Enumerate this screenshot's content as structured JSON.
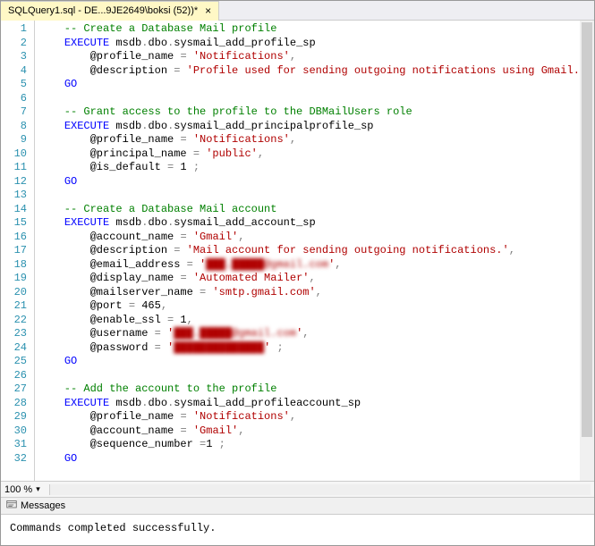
{
  "tab": {
    "title": "SQLQuery1.sql - DE...9JE2649\\boksi (52))*",
    "close": "×"
  },
  "status": {
    "zoom": "100 %",
    "drop": "▾"
  },
  "messages": {
    "header": "Messages",
    "body": "Commands completed successfully."
  },
  "code": {
    "lines": [
      {
        "n": "1",
        "parts": [
          {
            "cls": "c-comment",
            "t": "    -- Create a Database Mail profile"
          }
        ]
      },
      {
        "n": "2",
        "parts": [
          {
            "cls": "",
            "t": "    "
          },
          {
            "cls": "c-kw",
            "t": "EXECUTE"
          },
          {
            "cls": "",
            "t": " msdb"
          },
          {
            "cls": "c-gray",
            "t": "."
          },
          {
            "cls": "",
            "t": "dbo"
          },
          {
            "cls": "c-gray",
            "t": "."
          },
          {
            "cls": "",
            "t": "sysmail_add_profile_sp"
          }
        ]
      },
      {
        "n": "3",
        "parts": [
          {
            "cls": "",
            "t": "        @profile_name "
          },
          {
            "cls": "c-gray",
            "t": "="
          },
          {
            "cls": "",
            "t": " "
          },
          {
            "cls": "c-str",
            "t": "'Notifications'"
          },
          {
            "cls": "c-gray",
            "t": ","
          }
        ]
      },
      {
        "n": "4",
        "parts": [
          {
            "cls": "",
            "t": "        @description "
          },
          {
            "cls": "c-gray",
            "t": "="
          },
          {
            "cls": "",
            "t": " "
          },
          {
            "cls": "c-str",
            "t": "'Profile used for sending outgoing notifications using Gmail.'"
          },
          {
            "cls": "",
            "t": " "
          },
          {
            "cls": "c-gray",
            "t": ";"
          }
        ]
      },
      {
        "n": "5",
        "parts": [
          {
            "cls": "",
            "t": "    "
          },
          {
            "cls": "c-kw",
            "t": "GO"
          }
        ]
      },
      {
        "n": "6",
        "parts": [
          {
            "cls": "",
            "t": ""
          }
        ]
      },
      {
        "n": "7",
        "parts": [
          {
            "cls": "c-comment",
            "t": "    -- Grant access to the profile to the DBMailUsers role"
          }
        ]
      },
      {
        "n": "8",
        "parts": [
          {
            "cls": "",
            "t": "    "
          },
          {
            "cls": "c-kw",
            "t": "EXECUTE"
          },
          {
            "cls": "",
            "t": " msdb"
          },
          {
            "cls": "c-gray",
            "t": "."
          },
          {
            "cls": "",
            "t": "dbo"
          },
          {
            "cls": "c-gray",
            "t": "."
          },
          {
            "cls": "",
            "t": "sysmail_add_principalprofile_sp"
          }
        ]
      },
      {
        "n": "9",
        "parts": [
          {
            "cls": "",
            "t": "        @profile_name "
          },
          {
            "cls": "c-gray",
            "t": "="
          },
          {
            "cls": "",
            "t": " "
          },
          {
            "cls": "c-str",
            "t": "'Notifications'"
          },
          {
            "cls": "c-gray",
            "t": ","
          }
        ]
      },
      {
        "n": "10",
        "parts": [
          {
            "cls": "",
            "t": "        @principal_name "
          },
          {
            "cls": "c-gray",
            "t": "="
          },
          {
            "cls": "",
            "t": " "
          },
          {
            "cls": "c-str",
            "t": "'public'"
          },
          {
            "cls": "c-gray",
            "t": ","
          }
        ]
      },
      {
        "n": "11",
        "parts": [
          {
            "cls": "",
            "t": "        @is_default "
          },
          {
            "cls": "c-gray",
            "t": "="
          },
          {
            "cls": "",
            "t": " 1 "
          },
          {
            "cls": "c-gray",
            "t": ";"
          }
        ]
      },
      {
        "n": "12",
        "parts": [
          {
            "cls": "",
            "t": "    "
          },
          {
            "cls": "c-kw",
            "t": "GO"
          }
        ]
      },
      {
        "n": "13",
        "parts": [
          {
            "cls": "",
            "t": ""
          }
        ]
      },
      {
        "n": "14",
        "parts": [
          {
            "cls": "c-comment",
            "t": "    -- Create a Database Mail account"
          }
        ]
      },
      {
        "n": "15",
        "parts": [
          {
            "cls": "",
            "t": "    "
          },
          {
            "cls": "c-kw",
            "t": "EXECUTE"
          },
          {
            "cls": "",
            "t": " msdb"
          },
          {
            "cls": "c-gray",
            "t": "."
          },
          {
            "cls": "",
            "t": "dbo"
          },
          {
            "cls": "c-gray",
            "t": "."
          },
          {
            "cls": "",
            "t": "sysmail_add_account_sp"
          }
        ]
      },
      {
        "n": "16",
        "parts": [
          {
            "cls": "",
            "t": "        @account_name "
          },
          {
            "cls": "c-gray",
            "t": "="
          },
          {
            "cls": "",
            "t": " "
          },
          {
            "cls": "c-str",
            "t": "'Gmail'"
          },
          {
            "cls": "c-gray",
            "t": ","
          }
        ]
      },
      {
        "n": "17",
        "parts": [
          {
            "cls": "",
            "t": "        @description "
          },
          {
            "cls": "c-gray",
            "t": "="
          },
          {
            "cls": "",
            "t": " "
          },
          {
            "cls": "c-str",
            "t": "'Mail account for sending outgoing notifications.'"
          },
          {
            "cls": "c-gray",
            "t": ","
          }
        ]
      },
      {
        "n": "18",
        "parts": [
          {
            "cls": "",
            "t": "        @email_address "
          },
          {
            "cls": "c-gray",
            "t": "="
          },
          {
            "cls": "",
            "t": " "
          },
          {
            "cls": "c-str",
            "t": "'"
          },
          {
            "cls": "c-str blur",
            "t": "███.█████@gmail.com"
          },
          {
            "cls": "c-str",
            "t": "'"
          },
          {
            "cls": "c-gray",
            "t": ","
          }
        ]
      },
      {
        "n": "19",
        "parts": [
          {
            "cls": "",
            "t": "        @display_name "
          },
          {
            "cls": "c-gray",
            "t": "="
          },
          {
            "cls": "",
            "t": " "
          },
          {
            "cls": "c-str",
            "t": "'Automated Mailer'"
          },
          {
            "cls": "c-gray",
            "t": ","
          }
        ]
      },
      {
        "n": "20",
        "parts": [
          {
            "cls": "",
            "t": "        @mailserver_name "
          },
          {
            "cls": "c-gray",
            "t": "="
          },
          {
            "cls": "",
            "t": " "
          },
          {
            "cls": "c-str",
            "t": "'smtp.gmail.com'"
          },
          {
            "cls": "c-gray",
            "t": ","
          }
        ]
      },
      {
        "n": "21",
        "parts": [
          {
            "cls": "",
            "t": "        @port "
          },
          {
            "cls": "c-gray",
            "t": "="
          },
          {
            "cls": "",
            "t": " 465"
          },
          {
            "cls": "c-gray",
            "t": ","
          }
        ]
      },
      {
        "n": "22",
        "parts": [
          {
            "cls": "",
            "t": "        @enable_ssl "
          },
          {
            "cls": "c-gray",
            "t": "="
          },
          {
            "cls": "",
            "t": " 1"
          },
          {
            "cls": "c-gray",
            "t": ","
          }
        ]
      },
      {
        "n": "23",
        "parts": [
          {
            "cls": "",
            "t": "        @username "
          },
          {
            "cls": "c-gray",
            "t": "="
          },
          {
            "cls": "",
            "t": " "
          },
          {
            "cls": "c-str",
            "t": "'"
          },
          {
            "cls": "c-str blur",
            "t": "███.█████@gmail.com"
          },
          {
            "cls": "c-str",
            "t": "'"
          },
          {
            "cls": "c-gray",
            "t": ","
          }
        ]
      },
      {
        "n": "24",
        "parts": [
          {
            "cls": "",
            "t": "        @password "
          },
          {
            "cls": "c-gray",
            "t": "="
          },
          {
            "cls": "",
            "t": " "
          },
          {
            "cls": "c-str",
            "t": "'"
          },
          {
            "cls": "c-str blur",
            "t": "██████████████"
          },
          {
            "cls": "c-str",
            "t": "'"
          },
          {
            "cls": "",
            "t": " "
          },
          {
            "cls": "c-gray",
            "t": ";"
          }
        ]
      },
      {
        "n": "25",
        "parts": [
          {
            "cls": "",
            "t": "    "
          },
          {
            "cls": "c-kw",
            "t": "GO"
          }
        ]
      },
      {
        "n": "26",
        "parts": [
          {
            "cls": "",
            "t": ""
          }
        ]
      },
      {
        "n": "27",
        "parts": [
          {
            "cls": "c-comment",
            "t": "    -- Add the account to the profile"
          }
        ]
      },
      {
        "n": "28",
        "parts": [
          {
            "cls": "",
            "t": "    "
          },
          {
            "cls": "c-kw",
            "t": "EXECUTE"
          },
          {
            "cls": "",
            "t": " msdb"
          },
          {
            "cls": "c-gray",
            "t": "."
          },
          {
            "cls": "",
            "t": "dbo"
          },
          {
            "cls": "c-gray",
            "t": "."
          },
          {
            "cls": "",
            "t": "sysmail_add_profileaccount_sp"
          }
        ]
      },
      {
        "n": "29",
        "parts": [
          {
            "cls": "",
            "t": "        @profile_name "
          },
          {
            "cls": "c-gray",
            "t": "="
          },
          {
            "cls": "",
            "t": " "
          },
          {
            "cls": "c-str",
            "t": "'Notifications'"
          },
          {
            "cls": "c-gray",
            "t": ","
          }
        ]
      },
      {
        "n": "30",
        "parts": [
          {
            "cls": "",
            "t": "        @account_name "
          },
          {
            "cls": "c-gray",
            "t": "="
          },
          {
            "cls": "",
            "t": " "
          },
          {
            "cls": "c-str",
            "t": "'Gmail'"
          },
          {
            "cls": "c-gray",
            "t": ","
          }
        ]
      },
      {
        "n": "31",
        "parts": [
          {
            "cls": "",
            "t": "        @sequence_number "
          },
          {
            "cls": "c-gray",
            "t": "="
          },
          {
            "cls": "",
            "t": "1 "
          },
          {
            "cls": "c-gray",
            "t": ";"
          }
        ]
      },
      {
        "n": "32",
        "parts": [
          {
            "cls": "",
            "t": "    "
          },
          {
            "cls": "c-kw",
            "t": "GO"
          }
        ]
      }
    ]
  }
}
